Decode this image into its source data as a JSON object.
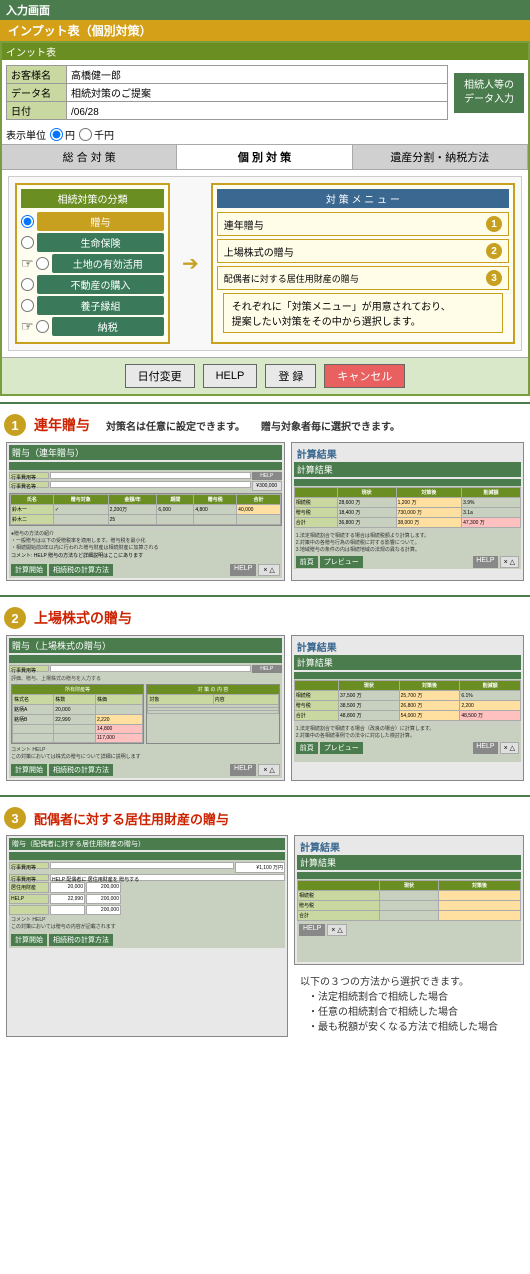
{
  "header": {
    "breadcrumb": "入力画面",
    "title": "インプット表（個別対策）",
    "subtitle": "インット表"
  },
  "form": {
    "customer_label": "お客様名",
    "customer_value": "高橋健一郎",
    "data_label": "データ名",
    "data_value": "相続対策のご提案",
    "date_label": "日付",
    "date_value": "/06/28",
    "unit_label": "表示単位",
    "unit_yen": "円",
    "unit_sen": "千円",
    "data_input_btn": "相続人等の\nデータ入力"
  },
  "tabs": [
    {
      "label": "総 合 対 策",
      "active": false
    },
    {
      "label": "個 別 対 策",
      "active": true
    },
    {
      "label": "遺産分割・納税方法",
      "active": false
    }
  ],
  "strategy": {
    "left_title": "相続対策の分類",
    "right_title": "対 策 メ ニ ュ ー",
    "items": [
      {
        "label": "贈与",
        "selected": true
      },
      {
        "label": "生命保険",
        "selected": false
      },
      {
        "label": "土地の有効活用",
        "selected": false
      },
      {
        "label": "不動産の購入",
        "selected": false
      },
      {
        "label": "養子縁組",
        "selected": false
      },
      {
        "label": "納税",
        "selected": false
      }
    ],
    "menu_items": [
      {
        "label": "連年贈与",
        "number": "1"
      },
      {
        "label": "上場株式の贈与",
        "number": "2"
      },
      {
        "label": "配偶者に対する居住用財産の贈与",
        "number": "3"
      }
    ],
    "note": "それぞれに「対策メニュー」が用意されており、\n提案したい対策をその中から選択します。"
  },
  "buttons": {
    "date_change": "日付変更",
    "help": "HELP",
    "register": "登 録",
    "cancel": "キャンセル"
  },
  "sections": [
    {
      "number": "1",
      "name": "連年贈与",
      "desc1": "対策名は任意に設定できます。",
      "desc2": "贈与対象者毎に選択できます。",
      "left_screen_title": "贈与（連年贈与）",
      "right_label": "計算結果",
      "right_screen_title": "計算結果"
    },
    {
      "number": "2",
      "name": "上場株式の贈与",
      "desc1": "",
      "desc2": "",
      "left_screen_title": "贈与（上場株式の贈与）",
      "right_label": "計算結果",
      "right_screen_title": "計算結果"
    },
    {
      "number": "3",
      "name": "配偶者に対する居住用財産の贈与",
      "desc1": "",
      "desc2": "",
      "left_screen_title": "贈与（配偶者に対する居住用財産の贈与）",
      "right_label": "計算結果",
      "right_screen_title": "計算結果",
      "note_title": "以下の３つの方法から選択できます。",
      "note_items": [
        "法定相続割合で相続した場合",
        "任意の相続割合で相続した場合",
        "最も税額が安くなる方法で相続した場合"
      ]
    }
  ]
}
